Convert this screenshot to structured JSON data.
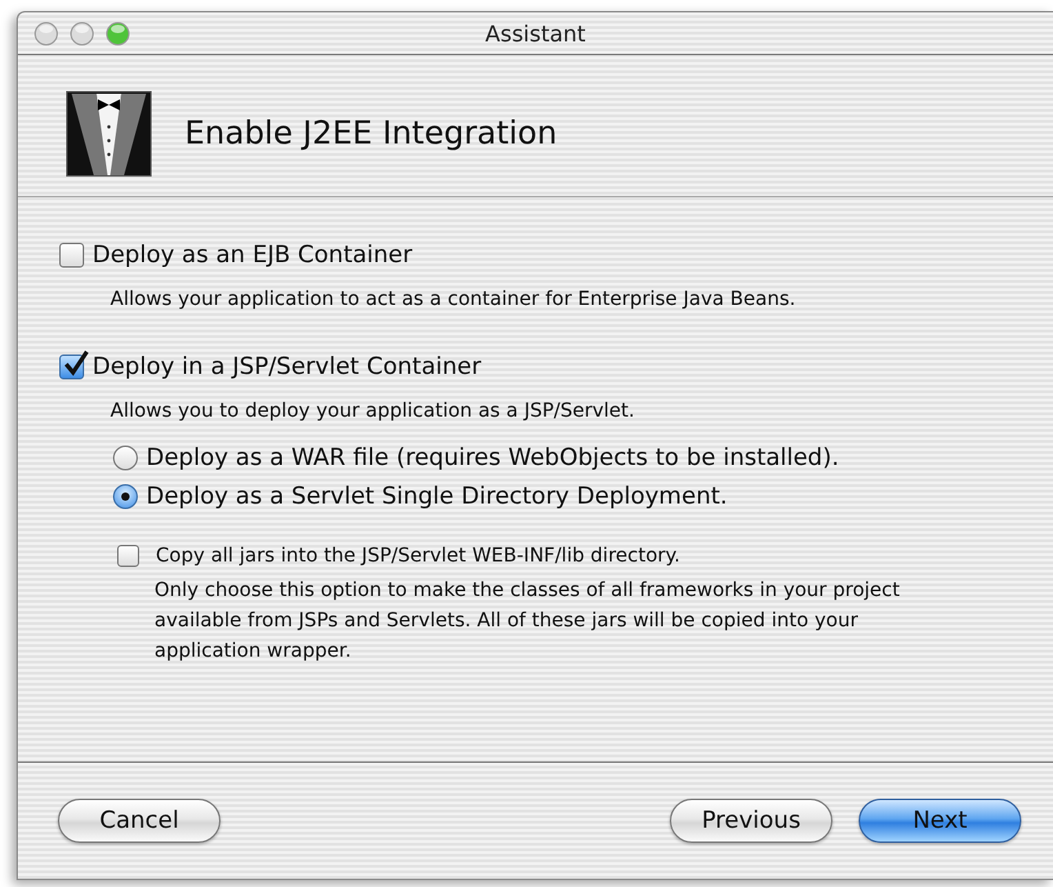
{
  "window": {
    "title": "Assistant"
  },
  "header": {
    "title": "Enable J2EE Integration"
  },
  "ejb": {
    "label": "Deploy as an EJB Container",
    "checked": false,
    "description": "Allows your application to act as a container for Enterprise Java Beans."
  },
  "servlet": {
    "label": "Deploy in a JSP/Servlet Container",
    "checked": true,
    "description": "Allows you to deploy your application as a JSP/Servlet.",
    "modes": [
      {
        "label": "Deploy as a WAR file (requires WebObjects to be installed).",
        "selected": false
      },
      {
        "label": "Deploy as a Servlet Single Directory Deployment.",
        "selected": true
      }
    ],
    "copy_jars": {
      "label": "Copy all jars into the JSP/Servlet WEB-INF/lib directory.",
      "checked": false,
      "description": "Only choose this option to make the classes of all frameworks in your project available from JSPs and Servlets. All of these jars will be copied into your application wrapper."
    }
  },
  "buttons": [
    {
      "label": "Cancel",
      "default": false
    },
    {
      "label": "Previous",
      "default": false
    },
    {
      "label": "Next",
      "default": true
    }
  ]
}
